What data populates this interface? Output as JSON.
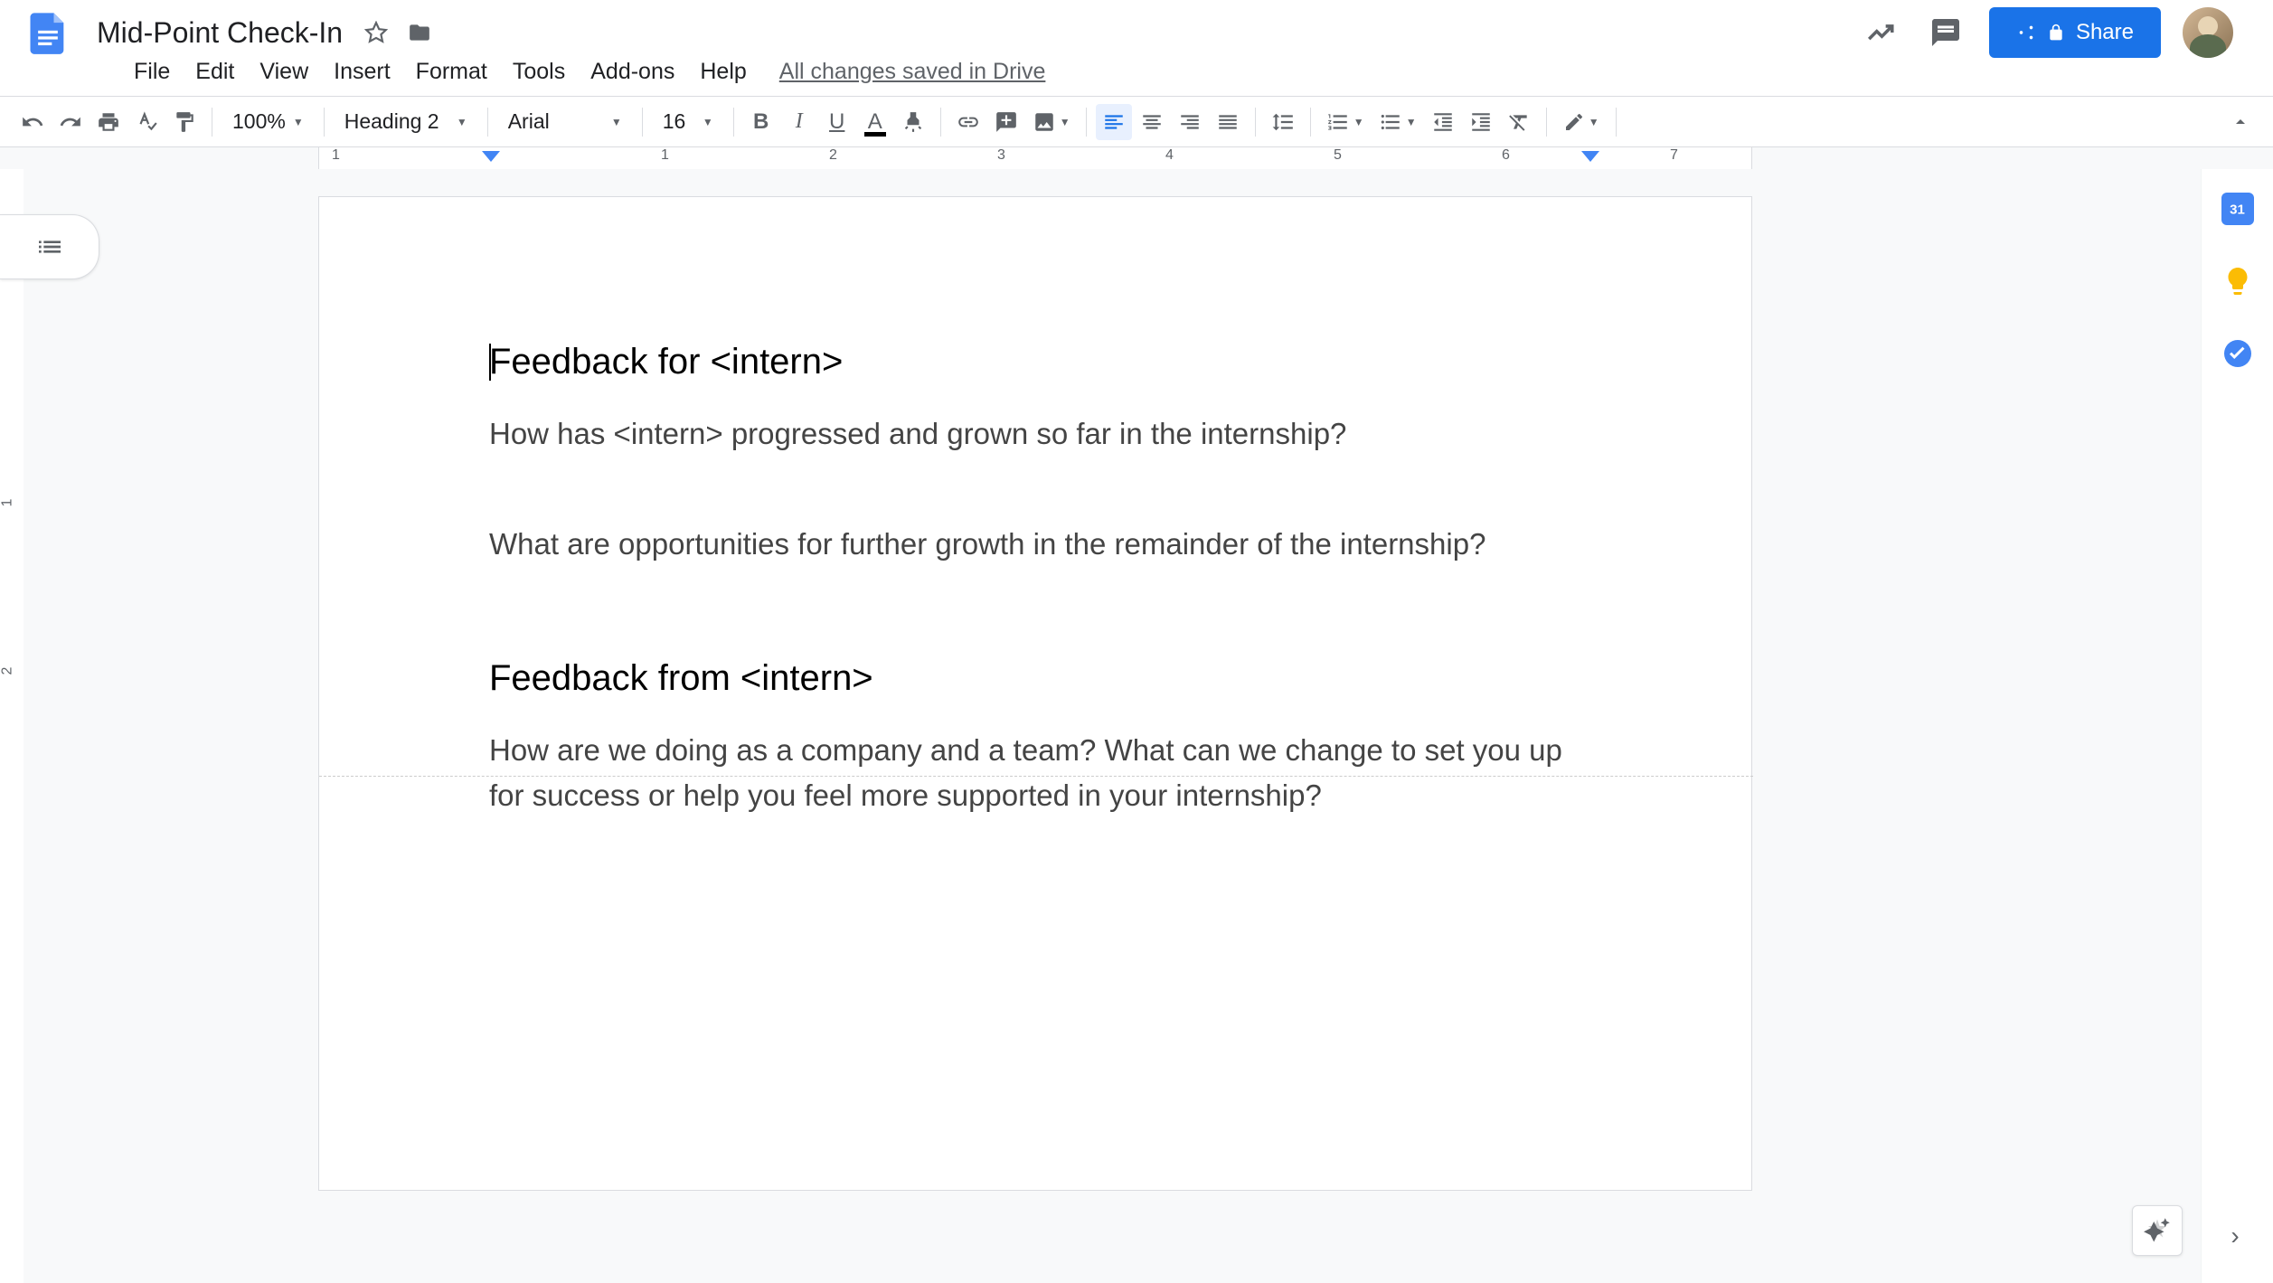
{
  "doc": {
    "title": "Mid-Point Check-In",
    "save_status": "All changes saved in Drive"
  },
  "menu": {
    "file": "File",
    "edit": "Edit",
    "view": "View",
    "insert": "Insert",
    "format": "Format",
    "tools": "Tools",
    "addons": "Add-ons",
    "help": "Help"
  },
  "toolbar": {
    "zoom": "100%",
    "style": "Heading 2",
    "font": "Arial",
    "size": "16",
    "share_label": "Share"
  },
  "ruler": {
    "ticks": [
      "1",
      "2",
      "3",
      "4",
      "5",
      "6",
      "7"
    ]
  },
  "content": {
    "h1": "Feedback for <intern>",
    "p1": "How has <intern> progressed and grown so far in the internship?",
    "p2": "What are opportunities for further growth in the remainder of the internship?",
    "h2": "Feedback from <intern>",
    "p3": "How are we doing as a company and a team? What can we change to set you up for success or help you feel more supported in your internship?"
  },
  "sidebar": {
    "calendar_day": "31"
  }
}
